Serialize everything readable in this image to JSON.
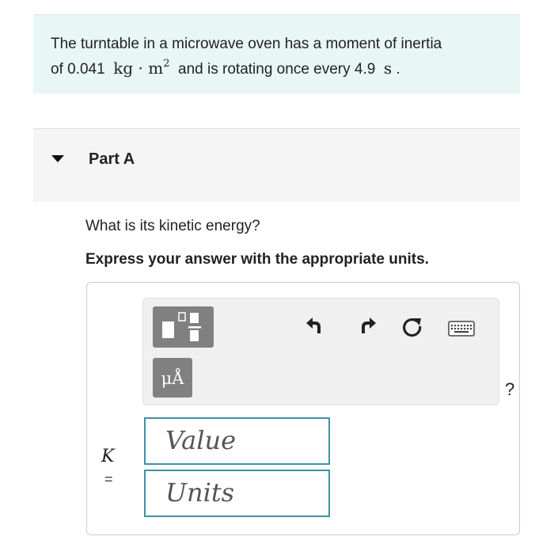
{
  "problem": {
    "text_1": "The turntable in a microwave oven has a moment of inertia",
    "text_2": "of 0.041",
    "unit_kg": "kg",
    "unit_dot": "·",
    "unit_m": "m",
    "unit_exp": "2",
    "text_3": "and is rotating once every 4.9",
    "unit_s": "s",
    "text_4": "."
  },
  "part": {
    "title": "Part A",
    "question": "What is its kinetic energy?",
    "instruction": "Express your answer with the appropriate units."
  },
  "toolbar": {
    "units_label": "μÅ",
    "help_label": "?",
    "icons": [
      "templates-icon",
      "undo-icon",
      "redo-icon",
      "reset-icon",
      "keyboard-icon"
    ]
  },
  "answer": {
    "variable": "K",
    "equals": "=",
    "value_placeholder": "Value",
    "units_placeholder": "Units"
  },
  "colors": {
    "problem_bg": "#e8f6f6",
    "input_border": "#3e91a6",
    "tool_button": "#808080"
  }
}
